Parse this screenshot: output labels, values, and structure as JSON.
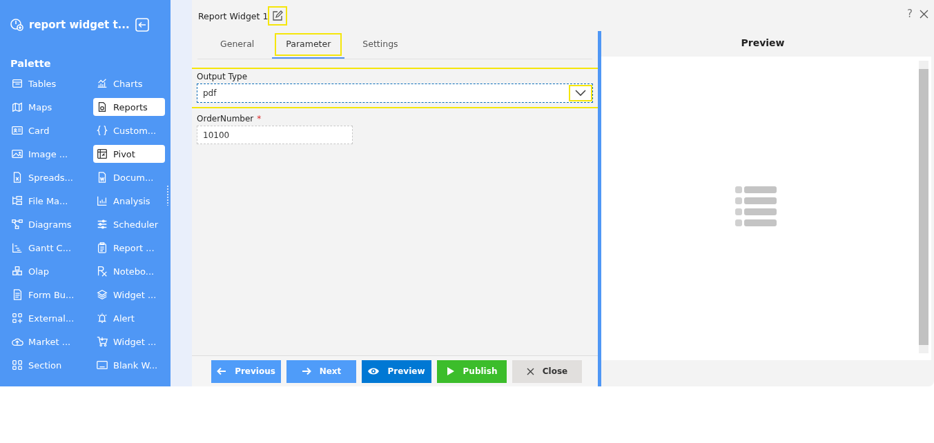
{
  "sidebar": {
    "title": "report widget t...",
    "palette_heading": "Palette",
    "items": [
      {
        "label": "Tables",
        "selected": false
      },
      {
        "label": "Charts",
        "selected": false
      },
      {
        "label": "Maps",
        "selected": false
      },
      {
        "label": "Reports",
        "selected": true
      },
      {
        "label": "Card",
        "selected": false
      },
      {
        "label": "Custom...",
        "selected": false
      },
      {
        "label": "Image ...",
        "selected": false
      },
      {
        "label": "Pivot",
        "selected": true
      },
      {
        "label": "Spreads...",
        "selected": false
      },
      {
        "label": "Docum...",
        "selected": false
      },
      {
        "label": "File Ma...",
        "selected": false
      },
      {
        "label": "Analysis",
        "selected": false
      },
      {
        "label": "Diagrams",
        "selected": false
      },
      {
        "label": "Scheduler",
        "selected": false
      },
      {
        "label": "Gantt C...",
        "selected": false
      },
      {
        "label": "Report ...",
        "selected": false
      },
      {
        "label": "Olap",
        "selected": false
      },
      {
        "label": "Notebo...",
        "selected": false
      },
      {
        "label": "Form Bu...",
        "selected": false
      },
      {
        "label": "Widget ...",
        "selected": false
      },
      {
        "label": "External...",
        "selected": false
      },
      {
        "label": "Alert",
        "selected": false
      },
      {
        "label": "Market ...",
        "selected": false
      },
      {
        "label": "Widget ...",
        "selected": false
      },
      {
        "label": "Section",
        "selected": false
      },
      {
        "label": "Blank W...",
        "selected": false
      }
    ]
  },
  "dialog": {
    "title": "Report Widget 1",
    "edit_highlighted": true,
    "tabs": [
      {
        "label": "General",
        "selected": false,
        "highlighted": false
      },
      {
        "label": "Parameter",
        "selected": true,
        "highlighted": true
      },
      {
        "label": "Settings",
        "selected": false,
        "highlighted": false
      }
    ],
    "fields": [
      {
        "label": "Output Type",
        "kind": "dropdown",
        "value": "pdf",
        "highlighted": true
      },
      {
        "label": "OrderNumber",
        "required_mark": "*",
        "kind": "text",
        "value": "10100",
        "highlighted": false
      }
    ],
    "buttons": [
      {
        "label": "Previous",
        "kind": "previous"
      },
      {
        "label": "Next",
        "kind": "next"
      },
      {
        "label": "Preview",
        "kind": "preview"
      },
      {
        "label": "Publish",
        "kind": "publish"
      },
      {
        "label": "Close",
        "kind": "close"
      }
    ],
    "help": "?",
    "preview_title": "Preview"
  }
}
